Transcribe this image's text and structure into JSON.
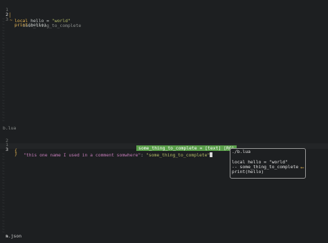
{
  "top_pane": {
    "lines": [
      {
        "num": "1",
        "sign": "",
        "kw": "local",
        "rest": " hello = ",
        "str": "\"world\""
      },
      {
        "num": "2",
        "sign": "~",
        "comment": "-- some_thing_to_complete"
      },
      {
        "num": "3",
        "sign": "",
        "fn": "print",
        "rest": "(hello)"
      }
    ]
  },
  "top_status": {
    "filename": "b.lua"
  },
  "bottom_pane": {
    "lines": [
      {
        "num": "2",
        "sign": ""
      },
      {
        "num": "1",
        "sign": "",
        "open": "{"
      },
      {
        "num": "3",
        "sign": "",
        "key": "\"this one name I used in a comment somwhere\"",
        "colon": ": ",
        "value": "\"some_thing_to_complete\""
      },
      {
        "num": "",
        "close": "}"
      }
    ]
  },
  "completion_item": {
    "label": "some_thing_to_complete = [text] [RG]"
  },
  "doc_popup": {
    "path": "./b.lua",
    "line1": "local hello = \"world\"",
    "line2": "-- some_thing_to_complete",
    "line3": "print(hello)",
    "arrow": "⟵"
  },
  "bottom_status": {
    "filename": "a.json",
    "modified_icon": "pencil-icon",
    "modified_glyph": "✎"
  }
}
